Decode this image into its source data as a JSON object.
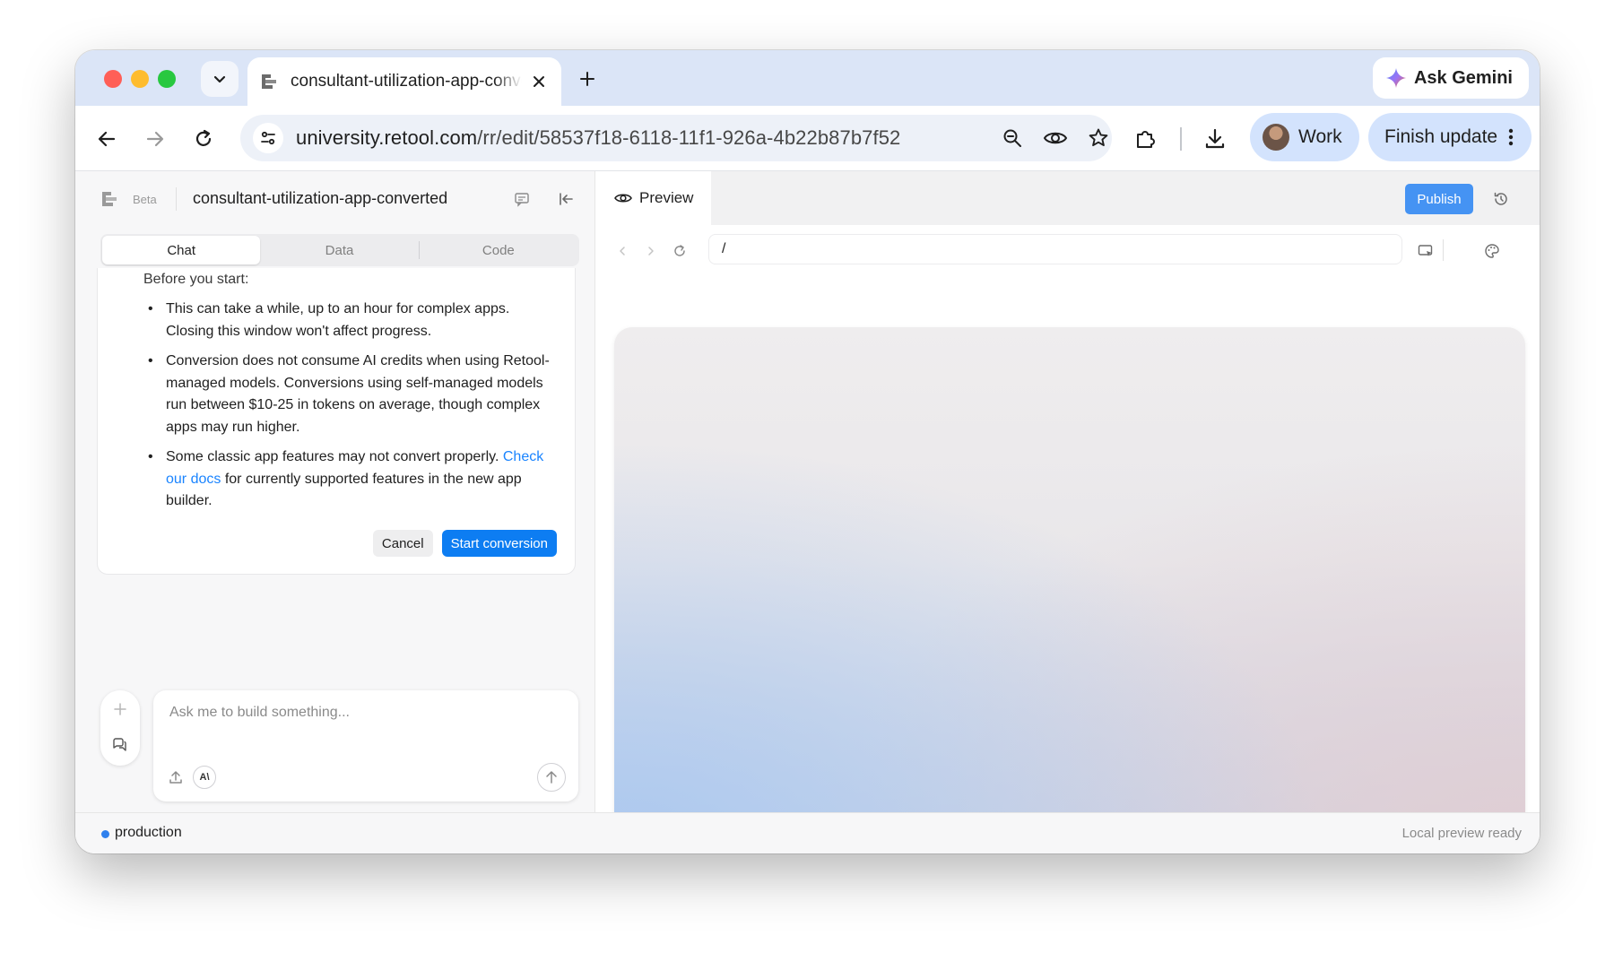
{
  "browser": {
    "tab_title": "consultant-utilization-app-converted",
    "ask_gemini_label": "Ask Gemini",
    "url_host": "university.retool.com",
    "url_path": "/rr/edit/58537f18-6118-11f1-926a-4b22b87b7f52",
    "profile_label": "Work",
    "finish_update_label": "Finish update"
  },
  "left_panel": {
    "beta_label": "Beta",
    "app_name": "consultant-utilization-app-converted",
    "tabs": [
      {
        "label": "Chat",
        "active": true
      },
      {
        "label": "Data",
        "active": false
      },
      {
        "label": "Code",
        "active": false
      }
    ],
    "card": {
      "heading": "Before you start:",
      "bullet_1": "This can take a while, up to an hour for complex apps. Closing this window won't affect progress.",
      "bullet_2": "Conversion does not consume AI credits when using Retool-managed models. Conversions using self-managed models run between $10-25 in tokens on average, though complex apps may run higher.",
      "bullet_3_before": "Some classic app features may not convert properly. ",
      "bullet_3_link": "Check our docs",
      "bullet_3_after": " for currently supported features in the new app builder.",
      "cancel_label": "Cancel",
      "start_label": "Start conversion"
    },
    "composer": {
      "placeholder": "Ask me to build something...",
      "model_badge": "A\\"
    }
  },
  "preview": {
    "tab_label": "Preview",
    "publish_label": "Publish",
    "path": "/"
  },
  "status_bar": {
    "environment": "production",
    "preview_status": "Local preview ready"
  },
  "colors": {
    "accent": "#0d7df2",
    "publish": "#4593f3",
    "link": "#1a84ff",
    "env_dot": "#2f80ed"
  }
}
